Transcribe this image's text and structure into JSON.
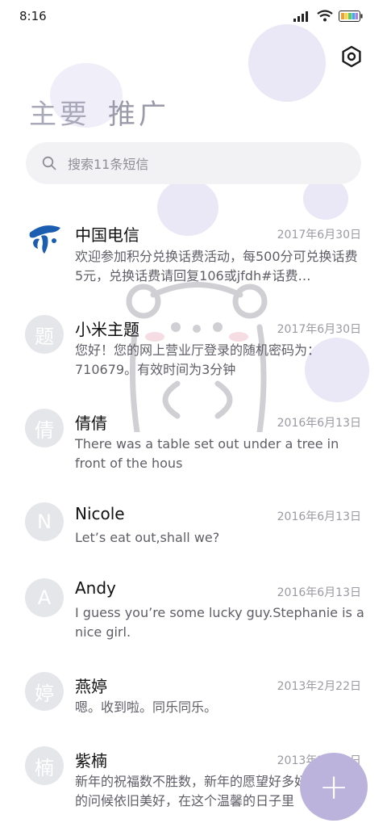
{
  "status_bar": {
    "time": "8:16"
  },
  "tabs": [
    {
      "label": "主要"
    },
    {
      "label": "推广"
    }
  ],
  "search": {
    "placeholder": "搜索11条短信"
  },
  "conversations": [
    {
      "avatar_text": "",
      "name": "中国电信",
      "date": "2017年6月30日",
      "preview": "欢迎参加积分兑换话费活动，每500分可兑换话费5元，兑换话费请回复106或jfdh#话费…"
    },
    {
      "avatar_text": "题",
      "name": "小米主题",
      "date": "2017年6月30日",
      "preview": "您好！您的网上营业厅登录的随机密码为：710679。有效时间为3分钟"
    },
    {
      "avatar_text": "倩",
      "name": "倩倩",
      "date": "2016年6月13日",
      "preview": "There was a table set out under a tree in front of the hous"
    },
    {
      "avatar_text": "N",
      "name": "Nicole",
      "date": "2016年6月13日",
      "preview": "Let’s eat out,shall we?"
    },
    {
      "avatar_text": "A",
      "name": "Andy",
      "date": "2016年6月13日",
      "preview": "I guess you’re some lucky guy.Stephanie is a nice girl."
    },
    {
      "avatar_text": "婷",
      "name": "燕婷",
      "date": "2013年2月22日",
      "preview": "嗯。收到啦。同乐同乐。"
    },
    {
      "avatar_text": "楠",
      "name": "紫楠",
      "date": "2013年2月22日",
      "preview": "新年的祝福数不胜数，新年的愿望好多好多，新年的问候依旧美好，在这个温馨的日子里"
    }
  ],
  "fab": {
    "label": "+"
  },
  "colors": {
    "accent": "#bbb3dc",
    "avatar_bg": "#e5e6ea",
    "telecom_blue": "#1b5db0"
  }
}
